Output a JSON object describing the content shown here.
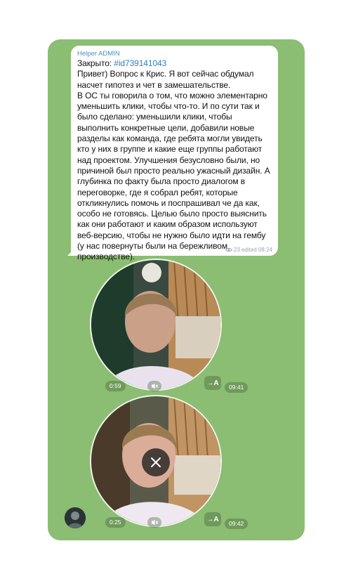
{
  "message": {
    "sender": "Helper ADMIN",
    "status_prefix": "Закрыто: ",
    "hashtag": "#id739141043",
    "paragraphs": [
      "Привет) Вопрос к Крис. Я вот сейчас обдумал насчет гипотез и чет в замешательстве.",
      "В ОС ты говорила о том, что можно элементарно уменьшить клики, чтобы что-то. И по сути так и было сделано: уменьшили клики, чтобы выполнить конкретные цели, добавили новые разделы как команда, где ребята могли увидеть кто у них в группе и какие еще группы работают над проектом. Улучшения безусловно были, но причиной был просто реально ужасный дизайн. А глубинка по факту была просто диалогом в переговорке, где я собрал ребят, которые откликнулись помочь и поспрашивал че да как, особо не готовясь. Целью было просто выяснить как они работают и каким образом используют веб-версию, чтобы не нужно было идти на гембу (у нас повернуты были на бережливом производстве)."
    ],
    "views": "23",
    "edited_time": "edited 08:24"
  },
  "video_notes": [
    {
      "duration": "0:59",
      "time": "09:41",
      "transcribe_label": "A"
    },
    {
      "duration": "0:25",
      "time": "09:42",
      "transcribe_label": "A"
    }
  ],
  "colors": {
    "chat_background": "#8bbd72",
    "bubble_background": "#ffffff",
    "sender_color": "#4c8fb8",
    "hashtag_color": "#2f7ec4"
  },
  "icons": [
    "eye-icon",
    "muted-speaker-icon",
    "transcribe-icon",
    "close-icon",
    "avatar"
  ]
}
